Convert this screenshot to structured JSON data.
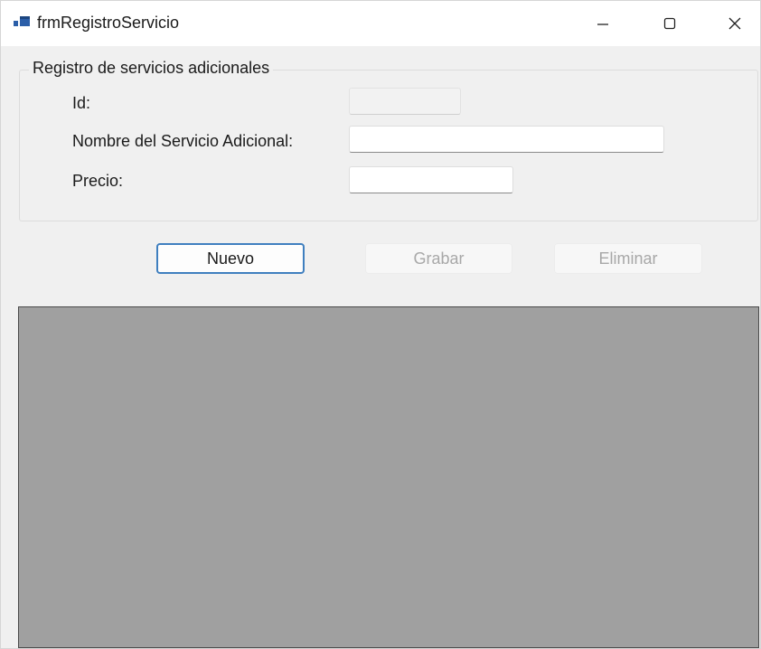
{
  "window": {
    "title": "frmRegistroServicio",
    "icon": "app-window-icon",
    "controls": {
      "minimize": "minimize-icon",
      "maximize": "maximize-icon",
      "close": "close-icon"
    }
  },
  "group": {
    "title": "Registro de servicios adicionales",
    "fields": {
      "id": {
        "label": "Id:",
        "value": "",
        "enabled": false
      },
      "nombre": {
        "label": "Nombre del Servicio Adicional:",
        "value": ""
      },
      "precio": {
        "label": "Precio:",
        "value": ""
      }
    }
  },
  "buttons": {
    "nuevo": "Nuevo",
    "grabar": "Grabar",
    "eliminar": "Eliminar"
  },
  "colors": {
    "accent_border": "#3f7fbf",
    "grid_background": "#a0a0a0",
    "form_background": "#f0f0f0"
  }
}
